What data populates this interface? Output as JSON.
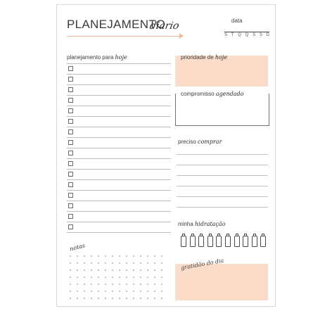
{
  "header": {
    "title": "PLANEJAMENTO",
    "title_script": "diario",
    "date_label": "data",
    "weekdays": [
      "S",
      "T",
      "Q",
      "Q",
      "S",
      "S",
      "D"
    ]
  },
  "planning": {
    "label": "planejamento para",
    "label_script": "hoje",
    "task_count": 16
  },
  "priority": {
    "label": "prioridade de",
    "label_script": "hoje"
  },
  "appointments": {
    "label": "compromisso",
    "label_script": "agendado"
  },
  "shopping": {
    "label": "preciso",
    "label_script": "comprar",
    "line_count": 6
  },
  "hydration": {
    "label": "minha",
    "label_script": "hidratação",
    "bottle_count": 10
  },
  "notes": {
    "label_script": "notas"
  },
  "gratitude": {
    "label_script": "gratidão do dia"
  },
  "colors": {
    "accent": "#fbdcc8",
    "accent_line": "#f0b89a"
  }
}
